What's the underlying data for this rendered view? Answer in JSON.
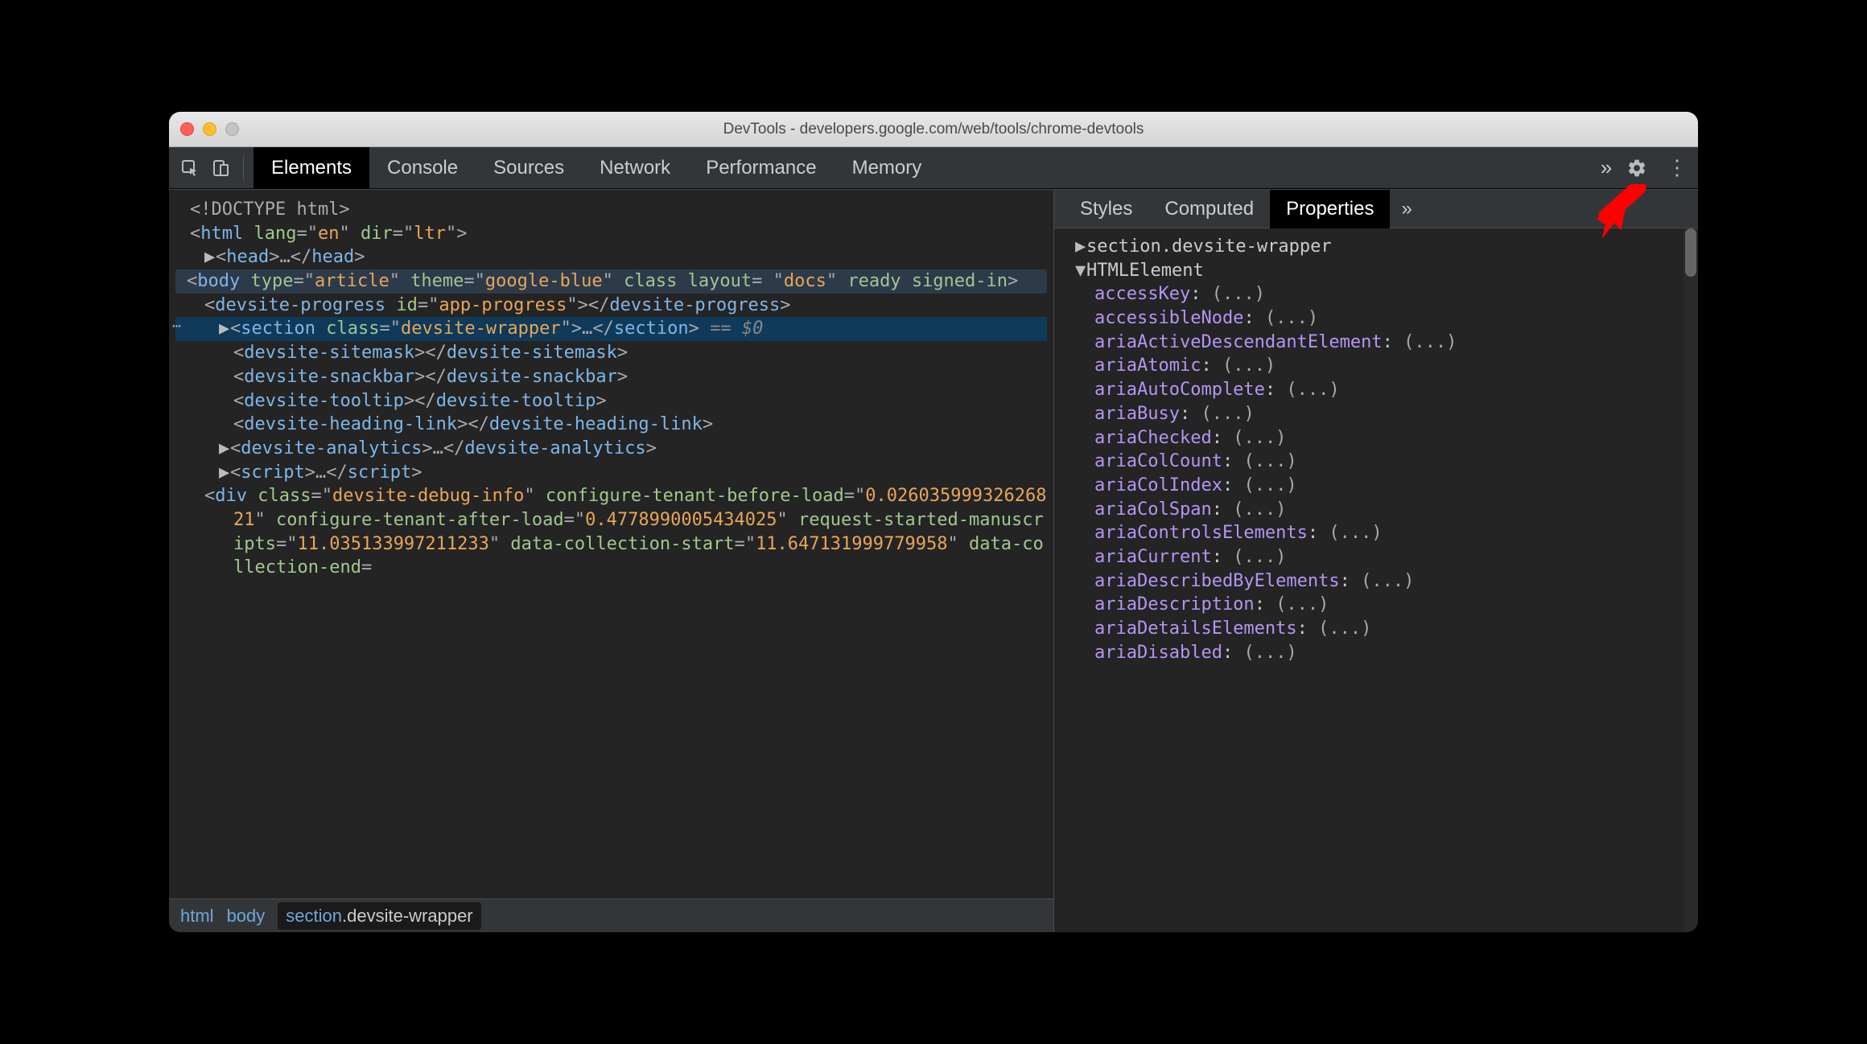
{
  "window": {
    "title": "DevTools - developers.google.com/web/tools/chrome-devtools"
  },
  "toolbar": {
    "tabs": [
      "Elements",
      "Console",
      "Sources",
      "Network",
      "Performance",
      "Memory"
    ],
    "active_tab": 0,
    "more_glyph": "»"
  },
  "dom": {
    "doctype": "<!DOCTYPE html>",
    "html_open": {
      "tag": "html",
      "attrs": [
        {
          "n": "lang",
          "v": "en"
        },
        {
          "n": "dir",
          "v": "ltr"
        }
      ]
    },
    "head": {
      "tag": "head",
      "ellipsis": "…"
    },
    "body": {
      "tag": "body",
      "attrs": [
        {
          "n": "type",
          "v": "article"
        },
        {
          "n": "theme",
          "v": "google-blue"
        }
      ],
      "bare": [
        "class",
        "layout="
      ],
      "quoted": "docs",
      "flags": [
        "ready",
        "signed-in"
      ]
    },
    "children": [
      {
        "type": "elem",
        "tag": "devsite-progress",
        "attrs": [
          {
            "n": "id",
            "v": "app-progress"
          }
        ],
        "close": true,
        "indent": 2
      },
      {
        "type": "selected",
        "tag": "section",
        "attrs": [
          {
            "n": "class",
            "v": "devsite-wrapper"
          }
        ],
        "ellipsis": "…",
        "eq": " == $0",
        "indent": 1,
        "tri": "▶"
      },
      {
        "type": "elem",
        "tag": "devsite-sitemask",
        "close": true,
        "indent": 2
      },
      {
        "type": "elem",
        "tag": "devsite-snackbar",
        "close": true,
        "indent": 2
      },
      {
        "type": "elem",
        "tag": "devsite-tooltip",
        "close": true,
        "indent": 2
      },
      {
        "type": "elem",
        "tag": "devsite-heading-link",
        "close": true,
        "indent": 2
      },
      {
        "type": "elem",
        "tag": "devsite-analytics",
        "ellipsis": "…",
        "close": true,
        "indent": 1,
        "tri": "▶"
      },
      {
        "type": "elem",
        "tag": "script",
        "ellipsis": "…",
        "close": true,
        "indent": 1,
        "tri": "▶"
      },
      {
        "type": "div",
        "tag": "div",
        "attrs": [
          {
            "n": "class",
            "v": "devsite-debug-info"
          }
        ],
        "trail": [
          {
            "n": "configure-tenant-before-load",
            "v": "0.02603599932626821"
          },
          {
            "n": "configure-tenant-after-load",
            "v": "0.4778990005434025"
          },
          {
            "n": "request-started-manuscripts",
            "v": "11.035133997211233"
          },
          {
            "n": "data-collection-start",
            "v": "11.647131999779958"
          },
          {
            "n": "data-collection-end",
            "v": ""
          }
        ],
        "indent": 2
      }
    ]
  },
  "breadcrumbs": [
    {
      "label": "html"
    },
    {
      "label": "body"
    },
    {
      "tag": "section",
      "cls": ".devsite-wrapper",
      "active": true
    }
  ],
  "sidebar": {
    "tabs": [
      "Styles",
      "Computed",
      "Properties"
    ],
    "active_tab": 2,
    "more_glyph": "»"
  },
  "properties": {
    "header": "section.devsite-wrapper",
    "class": "HTMLElement",
    "props": [
      "accessKey",
      "accessibleNode",
      "ariaActiveDescendantElement",
      "ariaAtomic",
      "ariaAutoComplete",
      "ariaBusy",
      "ariaChecked",
      "ariaColCount",
      "ariaColIndex",
      "ariaColSpan",
      "ariaControlsElements",
      "ariaCurrent",
      "ariaDescribedByElements",
      "ariaDescription",
      "ariaDetailsElements",
      "ariaDisabled"
    ],
    "value_placeholder": "(...)"
  }
}
